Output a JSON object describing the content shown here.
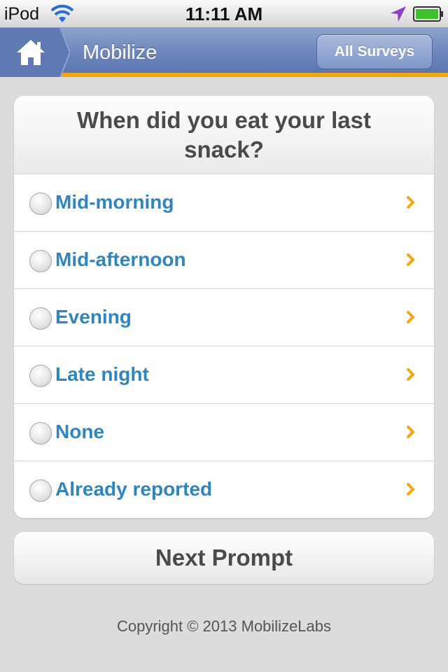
{
  "status_bar": {
    "carrier": "iPod",
    "time": "11:11 AM",
    "icons": [
      "wifi-icon",
      "location-icon",
      "battery-icon"
    ]
  },
  "nav_bar": {
    "title": "Mobilize",
    "home_icon": "home-icon",
    "all_surveys_label": "All Surveys"
  },
  "colors": {
    "nav_blue": "#6f88bd",
    "accent_orange": "#f3a70f",
    "option_blue": "#2d86bf"
  },
  "question": {
    "text": "When did you eat your last snack?",
    "options": [
      {
        "label": "Mid-morning"
      },
      {
        "label": "Mid-afternoon"
      },
      {
        "label": "Evening"
      },
      {
        "label": "Late night"
      },
      {
        "label": "None"
      },
      {
        "label": "Already reported"
      }
    ]
  },
  "next_button": {
    "label": "Next Prompt"
  },
  "footer": {
    "copyright": "Copyright © 2013 MobilizeLabs"
  }
}
